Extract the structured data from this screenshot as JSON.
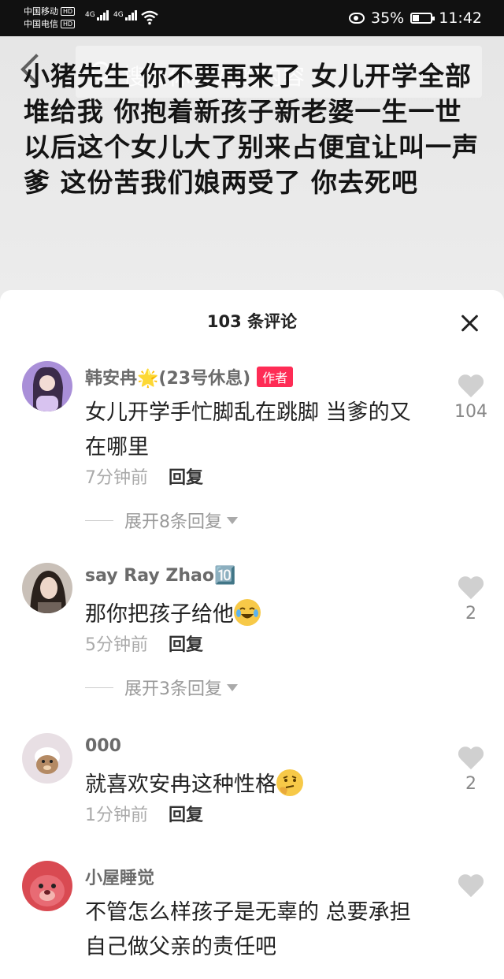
{
  "status": {
    "carrier1": "中国移动",
    "carrier2": "中国电信",
    "hd": "HD",
    "net1": "4G",
    "net2": "4G",
    "battery": "35%",
    "battery_level": 0.35,
    "time": "11:42"
  },
  "post": {
    "search_placeholder": "搜索你喜欢的内容",
    "text": "小猪先生 你不要再来了 女儿开学全部堆给我 你抱着新孩子新老婆一生一世 以后这个女儿大了别来占便宜让叫一声爹 这份苦我们娘两受了 你去死吧"
  },
  "comments_panel": {
    "title": "103 条评论",
    "comments": [
      {
        "user": "韩安冉🌟(23号休息)",
        "author_tag": "作者",
        "text": "女儿开学手忙脚乱在跳脚 当爹的又在哪里",
        "time": "7分钟前",
        "reply_label": "回复",
        "likes": "104",
        "expand": "展开8条回复"
      },
      {
        "user": "say Ray Zhao🔟",
        "text": "那你把孩子给他",
        "emoji": "crying-laughing-emoji",
        "time": "5分钟前",
        "reply_label": "回复",
        "likes": "2",
        "expand": "展开3条回复"
      },
      {
        "user": "000",
        "text": "就喜欢安冉这种性格",
        "emoji": "thinking-emoji",
        "time": "1分钟前",
        "reply_label": "回复",
        "likes": "2"
      },
      {
        "user": "小屋睡觉",
        "text": "不管怎么样孩子是无辜的 总要承担自己做父亲的责任吧",
        "likes": ""
      }
    ]
  },
  "colors": {
    "accent": "#fe2c55",
    "status_bg": "#111111"
  }
}
